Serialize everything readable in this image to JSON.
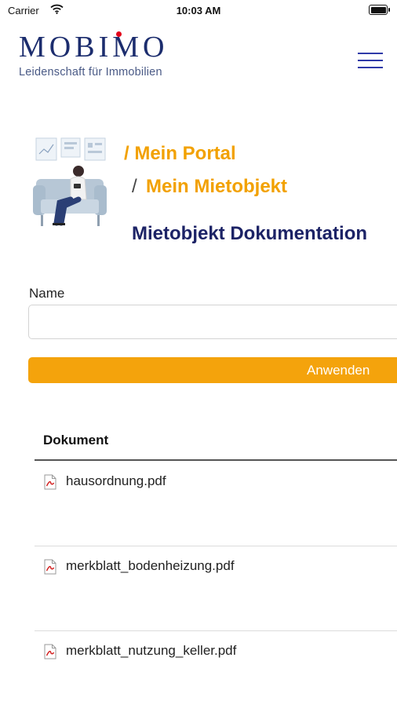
{
  "status_bar": {
    "carrier": "Carrier",
    "time": "10:03 AM",
    "battery_level": 1.0
  },
  "header": {
    "logo_text": "MOBIMO",
    "tagline": "Leidenschaft für Immobilien"
  },
  "breadcrumb": {
    "level1": "/ Mein Portal",
    "separator": "/",
    "level2": "Mein Mietobjekt"
  },
  "page_title": "Mietobjekt Dokumentation",
  "filter": {
    "label": "Name",
    "value": "",
    "placeholder": "",
    "apply_label": "Anwenden"
  },
  "table": {
    "header": "Dokument",
    "rows": [
      {
        "name": "hausordnung.pdf",
        "icon": "pdf-file-icon"
      },
      {
        "name": "merkblatt_bodenheizung.pdf",
        "icon": "pdf-file-icon"
      },
      {
        "name": "merkblatt_nutzung_keller.pdf",
        "icon": "pdf-file-icon"
      }
    ]
  },
  "colors": {
    "brand_blue": "#1c2d6e",
    "title_navy": "#1c2366",
    "accent_orange": "#f4a30c",
    "breadcrumb_orange": "#f2a100",
    "logo_dot_red": "#e2001a",
    "menu_blue": "#2f3aa8"
  }
}
